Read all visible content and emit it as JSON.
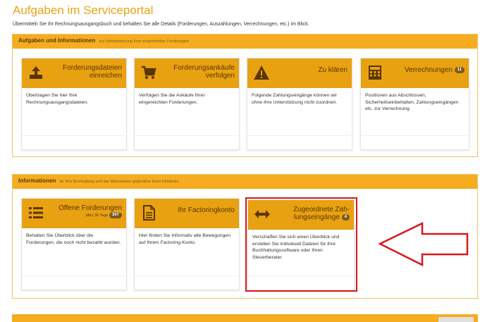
{
  "header": {
    "title": "Aufgaben im Serviceportal",
    "subtitle": "Übermitteln Sie Ihr Rechnungsausgangsbuch und behalten Sie alle Details (Forderungen, Auszahlungen, Verrechnungen, etc.) im Blick."
  },
  "panel_tasks": {
    "title": "Aufgaben und Informationen",
    "note": "zur Vorfinanzierung Ihrer eingereichten Forderungen",
    "cards": [
      {
        "icon": "upload-icon",
        "title": "Forderungsdateien einreichen",
        "title_line1": "Forderungsdateien",
        "title_line2": "einreichen",
        "body": "Übertragen Sie hier Ihre Rechnungsausgangsdateien."
      },
      {
        "icon": "shopping-cart-icon",
        "title": "Forderungsankäufe verfolgen",
        "title_line1": "Forderungsankäufe",
        "title_line2": "verfolgen",
        "body": "Verfolgen Sie die Ankäufe Ihrer eingereichten Forderungen."
      },
      {
        "icon": "warning-icon",
        "title": "Zu klären",
        "body": "Folgende Zahlungseingänge können wir ohne Ihre Unterstützung nicht zuordnen."
      },
      {
        "icon": "calculator-icon",
        "title": "Verrechnungen",
        "badge": "11",
        "body": "Positionen aus Abschlüssen, Sicherheitseinbehalten, Zahlungseingängen etc. zur Verrechnung."
      }
    ]
  },
  "panel_info": {
    "title": "Informationen",
    "note": "für Ihre Buchhaltung und das Mahnwesen gegenüber Ihren Debitoren",
    "cards": [
      {
        "icon": "list-icon",
        "title": "Offene Forderungen",
        "note": "älter 30 Tage",
        "badge": "307",
        "body": "Behalten Sie Überblick über die Forderungen, die noch nicht bezahlt wurden."
      },
      {
        "icon": "document-icon",
        "title": "Ihr Factoringkonto",
        "body": "Hier finden Sie informativ alle Bewegungen auf Ihrem Factoring-Konto."
      },
      {
        "icon": "arrows-horizontal-icon",
        "title": "Zugeordnete Zahlungseingänge",
        "title_line1": "Zugeordnete Zah-",
        "title_line2": "lungseingänge",
        "badge": "4",
        "body": "Verschaffen Sie sich einen Überblick und erstellen Sie individuell Dateien für Ihre Buchhaltungssoftware oder Ihren Steuerberater."
      }
    ]
  },
  "colors": {
    "accent": "#f5ac1f",
    "card_head": "#e8a111",
    "title": "#e8a317",
    "highlight": "#d9161d"
  }
}
